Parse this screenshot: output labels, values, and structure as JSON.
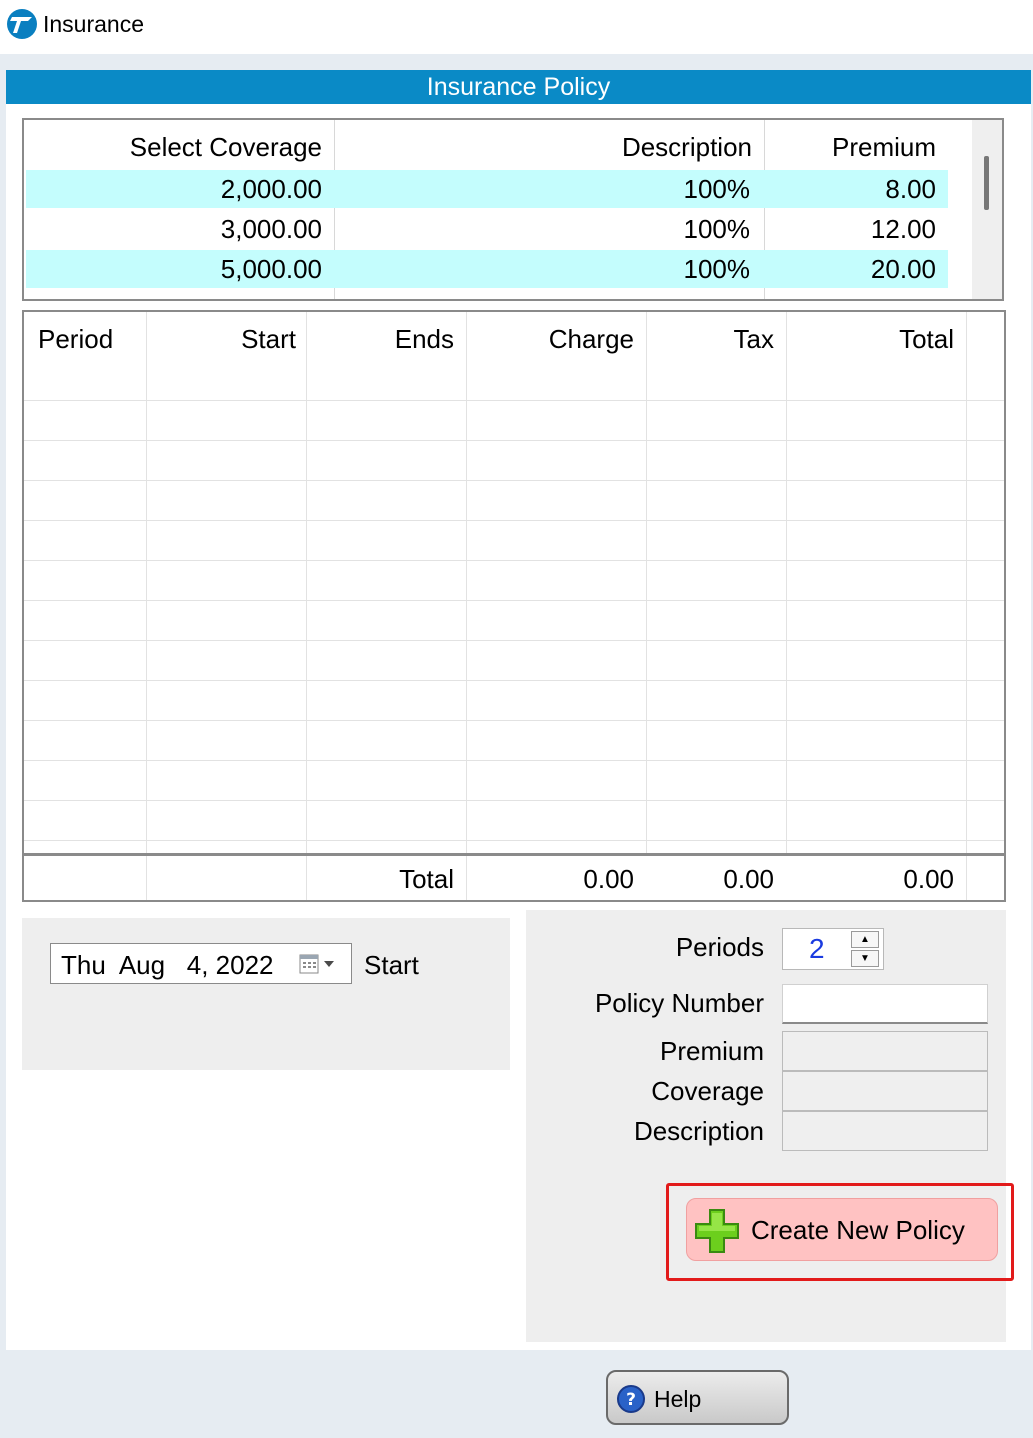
{
  "window": {
    "title": "Insurance",
    "icon": "app-logo-icon"
  },
  "header": {
    "title": "Insurance Policy"
  },
  "coverage_table": {
    "columns": [
      "Select Coverage",
      "Description",
      "Premium"
    ],
    "rows": [
      {
        "coverage": "2,000.00",
        "description": "100%",
        "premium": "8.00"
      },
      {
        "coverage": "3,000.00",
        "description": "100%",
        "premium": "12.00"
      },
      {
        "coverage": "5,000.00",
        "description": "100%",
        "premium": "20.00"
      }
    ]
  },
  "period_table": {
    "columns": [
      "Period",
      "Start",
      "Ends",
      "Charge",
      "Tax",
      "Total"
    ],
    "totals": {
      "label": "Total",
      "charge": "0.00",
      "tax": "0.00",
      "total": "0.00"
    }
  },
  "start": {
    "date": "Thu  Aug   4, 2022",
    "label": "Start"
  },
  "policy": {
    "periods_label": "Periods",
    "periods_value": "2",
    "policy_number_label": "Policy Number",
    "policy_number_value": "",
    "premium_label": "Premium",
    "coverage_label": "Coverage",
    "description_label": "Description"
  },
  "buttons": {
    "create": "Create New Policy",
    "help": "Help"
  },
  "colors": {
    "header": "#0a8ac6",
    "row_highlight": "#c4fdfd",
    "create_bg": "#ffc2c2",
    "create_outline": "#e21a1a"
  }
}
